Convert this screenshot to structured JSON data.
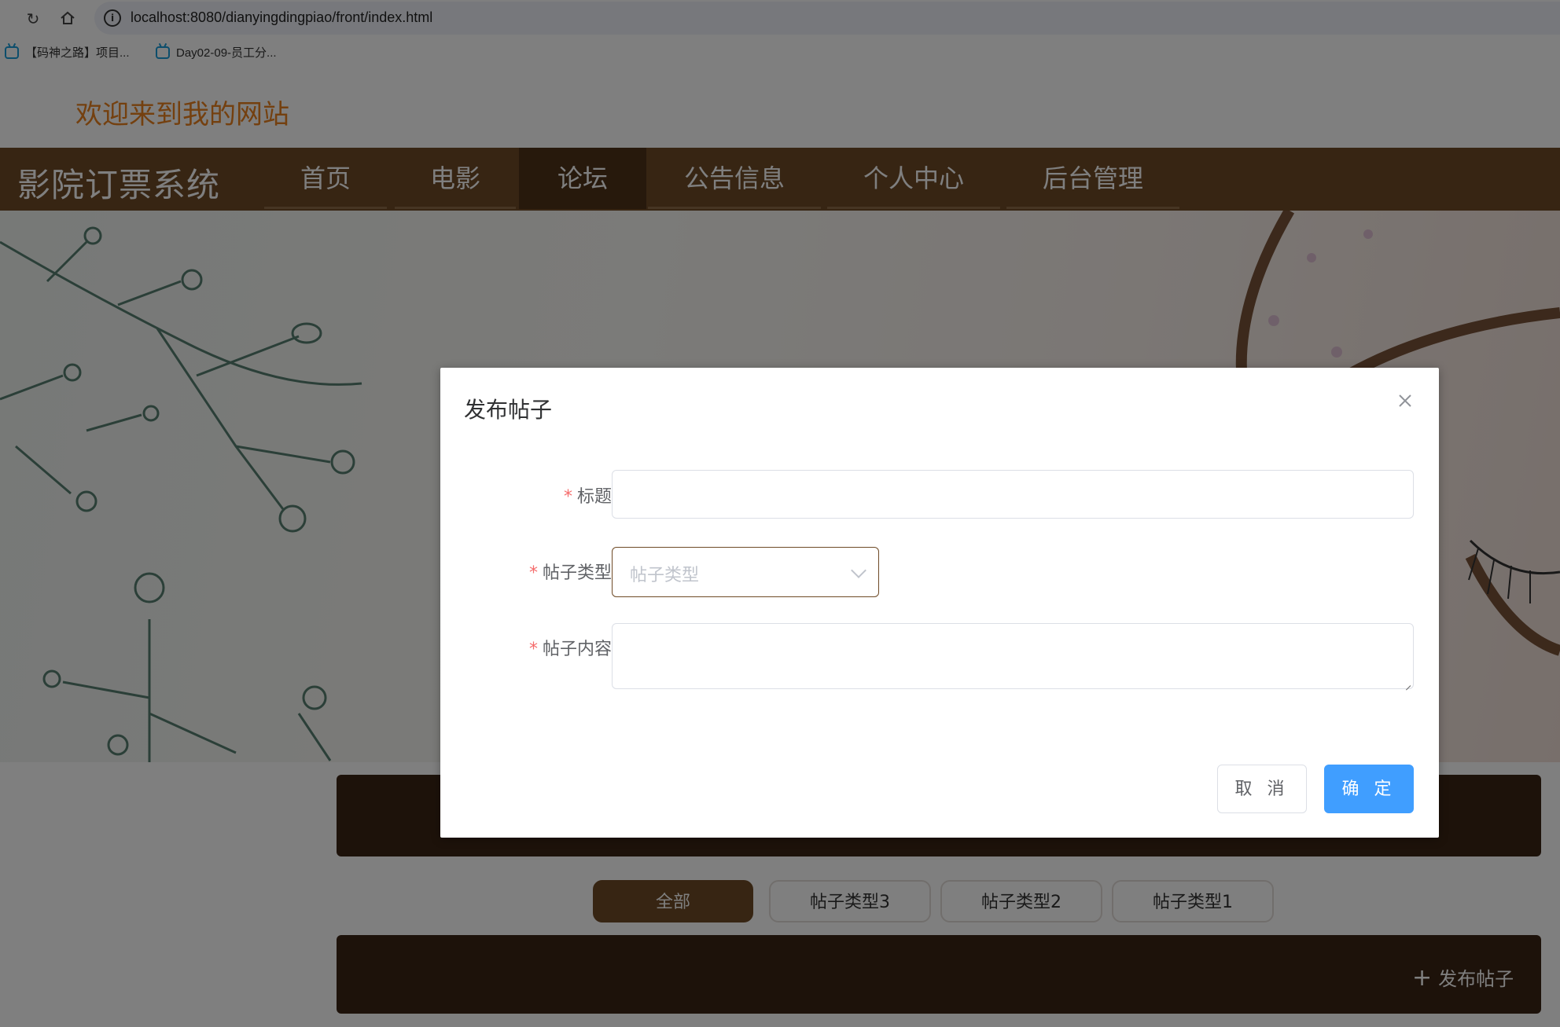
{
  "browser": {
    "url": "localhost:8080/dianyingdingpiao/front/index.html",
    "bookmarks": [
      "【码神之路】项目...",
      "Day02-09-员工分..."
    ]
  },
  "site": {
    "welcome": "欢迎来到我的网站",
    "brand": "影院订票系统",
    "nav": [
      {
        "label": "首页",
        "active": false
      },
      {
        "label": "电影",
        "active": false
      },
      {
        "label": "论坛",
        "active": true
      },
      {
        "label": "公告信息",
        "active": false
      },
      {
        "label": "个人中心",
        "active": false
      },
      {
        "label": "后台管理",
        "active": false
      }
    ]
  },
  "forum": {
    "filters": [
      {
        "label": "全部",
        "active": true
      },
      {
        "label": "帖子类型3",
        "active": false
      },
      {
        "label": "帖子类型2",
        "active": false
      },
      {
        "label": "帖子类型1",
        "active": false
      }
    ],
    "publish_label": "发布帖子"
  },
  "dialog": {
    "title": "发布帖子",
    "fields": {
      "title_label": "标题",
      "type_label": "帖子类型",
      "type_placeholder": "帖子类型",
      "content_label": "帖子内容",
      "required_mark": "*"
    },
    "cancel_label": "取 消",
    "ok_label": "确 定"
  },
  "colors": {
    "brand_brown": "#6e4a26",
    "welcome_orange": "#e8801e",
    "primary_blue": "#409eff",
    "required_red": "#f56c6c"
  }
}
